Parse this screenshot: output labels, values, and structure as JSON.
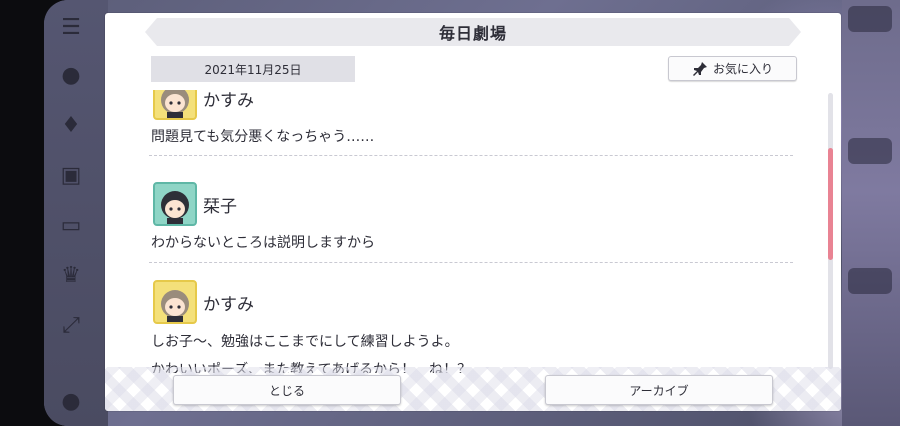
{
  "dialog": {
    "title": "毎日劇場",
    "date": "2021年11月25日",
    "favorite_label": "お気に入り",
    "close_label": "とじる",
    "archive_label": "アーカイブ"
  },
  "messages": [
    {
      "speaker": "かすみ",
      "avatar": "kasumi",
      "lines": [
        "問題見ても気分悪くなっちゃう……"
      ]
    },
    {
      "speaker": "栞子",
      "avatar": "shioriko",
      "lines": [
        "わからないところは説明しますから"
      ]
    },
    {
      "speaker": "かすみ",
      "avatar": "kasumi",
      "lines": [
        "しお子〜、勉強はここまでにして練習しようよ。",
        "かわいいポーズ、また教えてあげるから！　ね！？"
      ]
    }
  ],
  "colors": {
    "scroll_thumb": "#e98393",
    "title_bar": "#e9e9ed",
    "date_box": "#e0e0e6"
  },
  "icons": {
    "favorite": "pin-icon",
    "menu": "menu-icon"
  }
}
